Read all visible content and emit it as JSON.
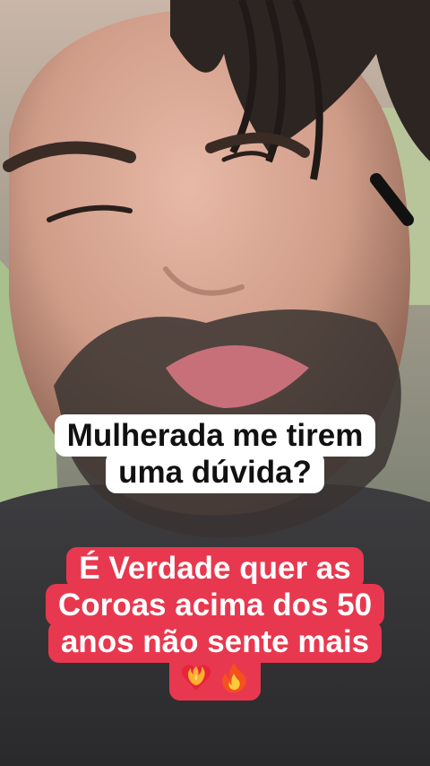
{
  "video": {
    "subject": "selfie-photo"
  },
  "captions": {
    "question_lines": [
      "Mulherada me tirem",
      "uma dúvida?"
    ],
    "statement_lines": [
      "É Verdade quer as",
      "Coroas  acima dos 50",
      "anos não sente mais"
    ],
    "emojis": [
      "heart-on-fire-icon",
      "fire-icon"
    ]
  },
  "colors": {
    "question_bg": "#ffffff",
    "question_text": "#111111",
    "statement_bg": "#e8384f",
    "statement_text": "#ffffff"
  }
}
